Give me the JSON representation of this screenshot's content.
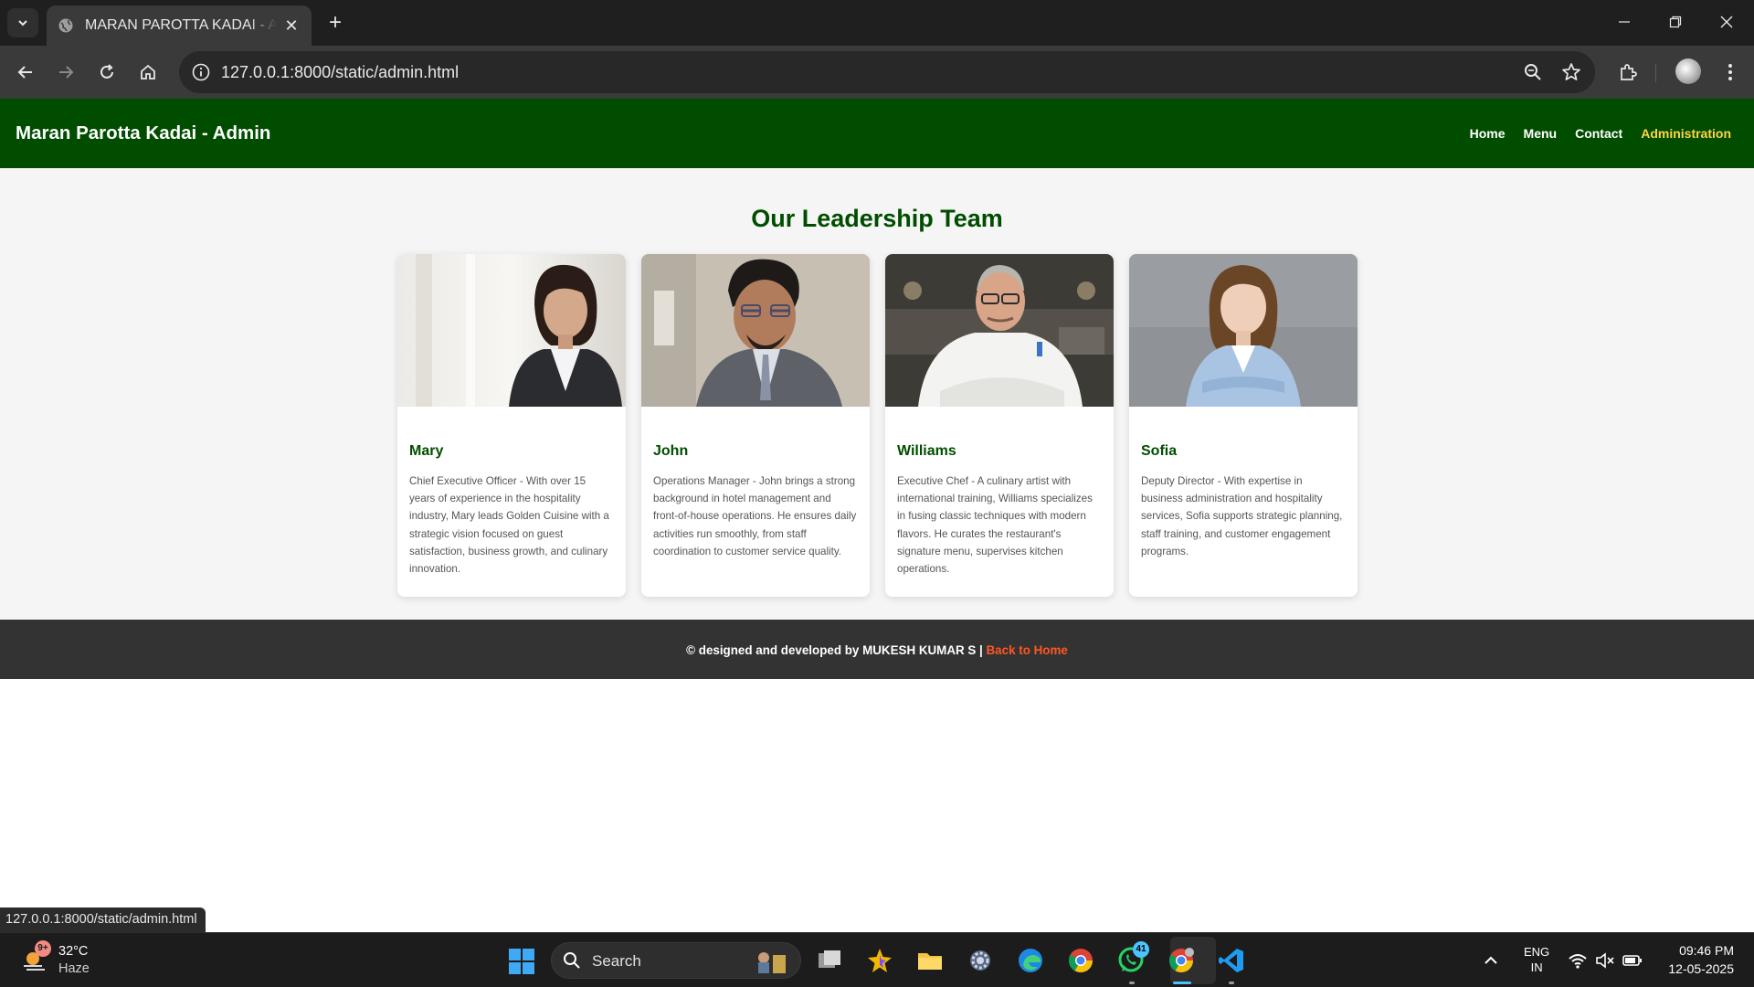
{
  "browser": {
    "tab_title": "MARAN PAROTTA KADAI - Admin",
    "url": "127.0.0.1:8000/static/admin.html",
    "status_url": "127.0.0.1:8000/static/admin.html"
  },
  "site": {
    "title": "Maran Parotta Kadai - Admin",
    "nav": [
      {
        "label": "Home"
      },
      {
        "label": "Menu"
      },
      {
        "label": "Contact"
      },
      {
        "label": "Administration",
        "active": true
      }
    ]
  },
  "main": {
    "heading": "Our Leadership Team",
    "team": [
      {
        "name": "Mary",
        "description": "Chief Executive Officer - With over 15 years of experience in the hospitality industry, Mary leads Golden Cuisine with a strategic vision focused on guest satisfaction, business growth, and culinary innovation."
      },
      {
        "name": "John",
        "description": "Operations Manager - John brings a strong background in hotel management and front-of-house operations. He ensures daily activities run smoothly, from staff coordination to customer service quality."
      },
      {
        "name": "Williams",
        "description": "Executive Chef - A culinary artist with international training, Williams specializes in fusing classic techniques with modern flavors. He curates the restaurant's signature menu, supervises kitchen operations."
      },
      {
        "name": "Sofia",
        "description": "Deputy Director - With expertise in business administration and hospitality services, Sofia supports strategic planning, staff training, and customer engagement programs."
      }
    ]
  },
  "footer": {
    "credit": "© designed and developed by MUKESH KUMAR S | ",
    "link": "Back to Home"
  },
  "taskbar": {
    "weather_temp": "32°C",
    "weather_cond": "Haze",
    "weather_badge": "9+",
    "search_label": "Search",
    "whatsapp_badge": "41",
    "lang_line1": "ENG",
    "lang_line2": "IN",
    "time": "09:46 PM",
    "date": "12-05-2025"
  },
  "colors": {
    "header_green": "#004d00",
    "active_nav": "#ffd54a",
    "footer_bg": "#333333",
    "footer_link": "#ff5722"
  }
}
